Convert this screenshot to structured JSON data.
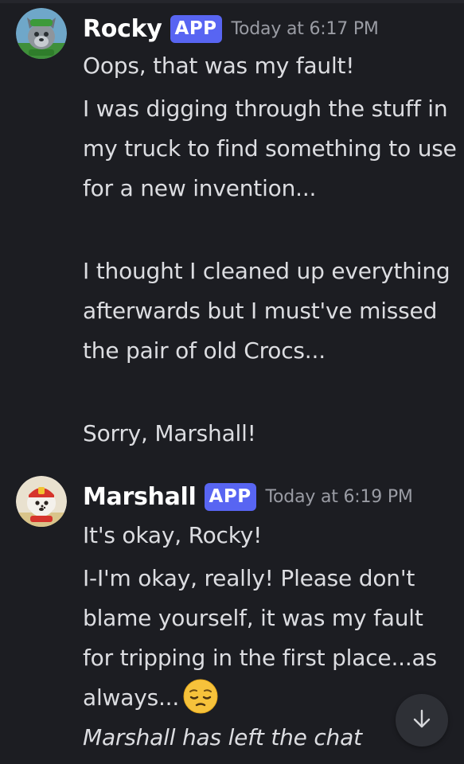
{
  "messages": [
    {
      "username": "Rocky",
      "app_tag": "APP",
      "timestamp": "Today at 6:17 PM",
      "avatar": "rocky-avatar",
      "lines": [
        "Oops, that was my fault!",
        "I was digging through the stuff in my truck to find something to use for a new invention...",
        "I thought I cleaned up everything afterwards but I must've missed the pair of old Crocs...",
        "Sorry, Marshall!"
      ]
    },
    {
      "username": "Marshall",
      "app_tag": "APP",
      "timestamp": "Today at 6:19 PM",
      "avatar": "marshall-avatar",
      "lines": [
        "It's okay, Rocky!",
        "I-I'm okay, really!  Please don't blame yourself, it was my fault for tripping in the first place...as always...",
        "Marshall has left the chat"
      ],
      "emoji": "pensive-face-emoji"
    }
  ],
  "scroll_button_icon": "arrow-down-icon",
  "colors": {
    "background": "#1c1d22",
    "app_tag": "#5865f2",
    "username": "#ffffff",
    "timestamp": "#9a9ca4",
    "message_text": "#dcdde1"
  }
}
